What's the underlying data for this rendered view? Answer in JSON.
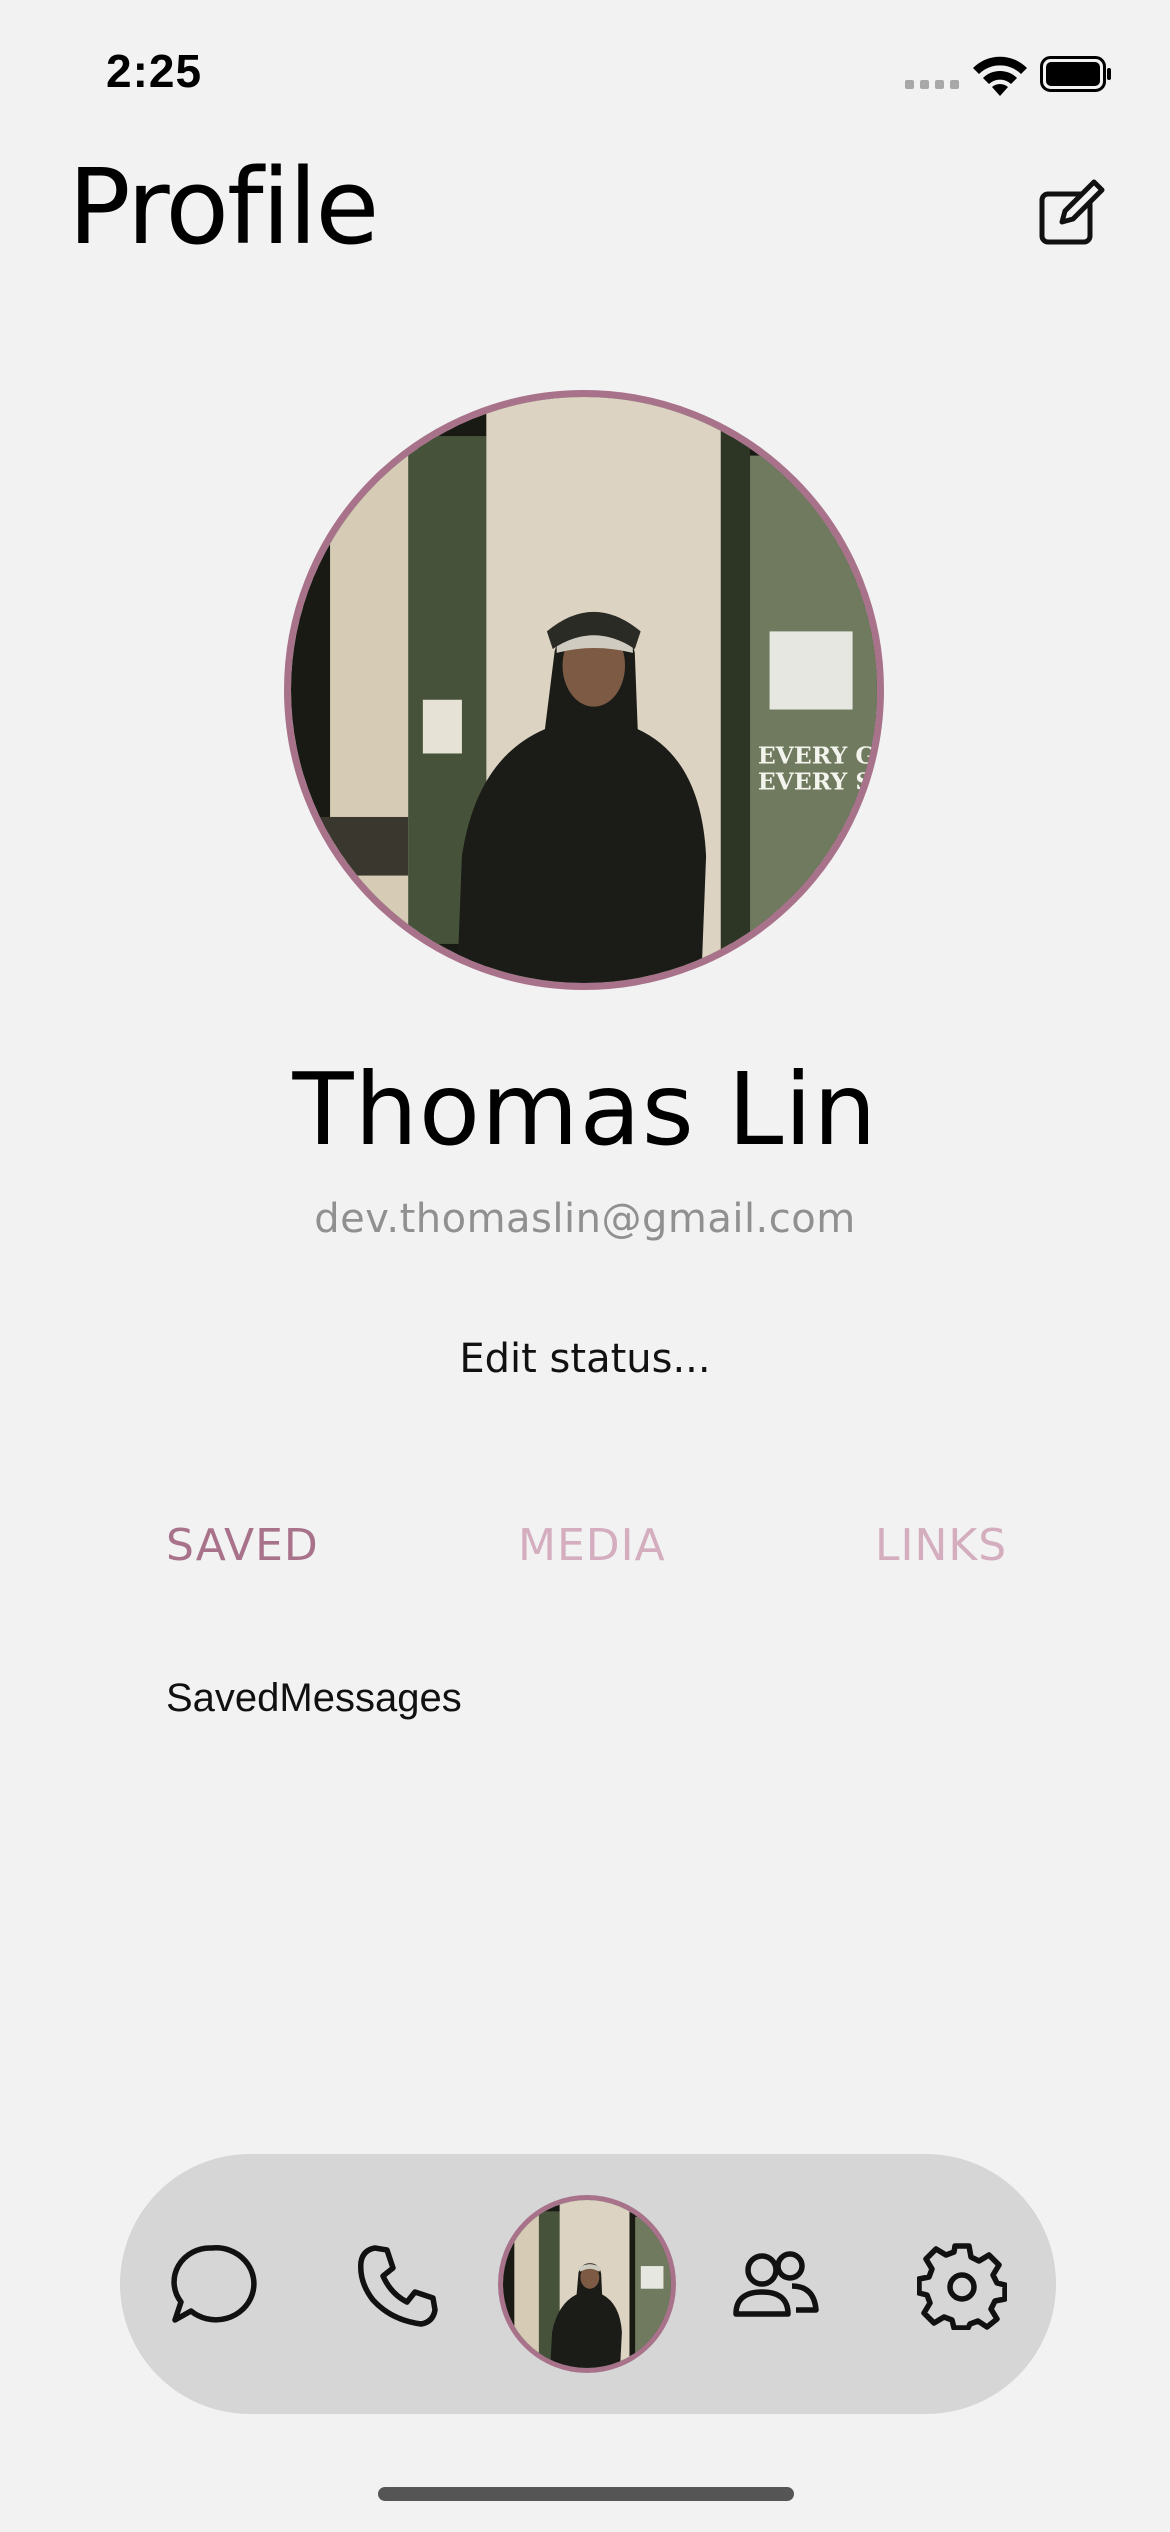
{
  "status_bar": {
    "time": "2:25"
  },
  "header": {
    "title": "Profile",
    "edit_icon": "edit-square-icon"
  },
  "profile": {
    "name": "Thomas Lin",
    "email": "dev.thomaslin@gmail.com",
    "status_prompt": "Edit status...",
    "photo_sign_text": [
      "EVERY GA",
      "EVERY SUN"
    ]
  },
  "tabs": [
    {
      "label": "SAVED",
      "active": true
    },
    {
      "label": "MEDIA",
      "active": false
    },
    {
      "label": "LINKS",
      "active": false
    }
  ],
  "content": {
    "saved_label": "SavedMessages"
  },
  "bottom_nav": {
    "items": [
      "chat-icon",
      "phone-icon",
      "profile-avatar",
      "people-icon",
      "settings-icon"
    ]
  },
  "colors": {
    "background": "#f2f2f2",
    "accent": "#a8738a",
    "tab_inactive": "#d4aebe",
    "nav_bg": "#d6d6d6"
  }
}
